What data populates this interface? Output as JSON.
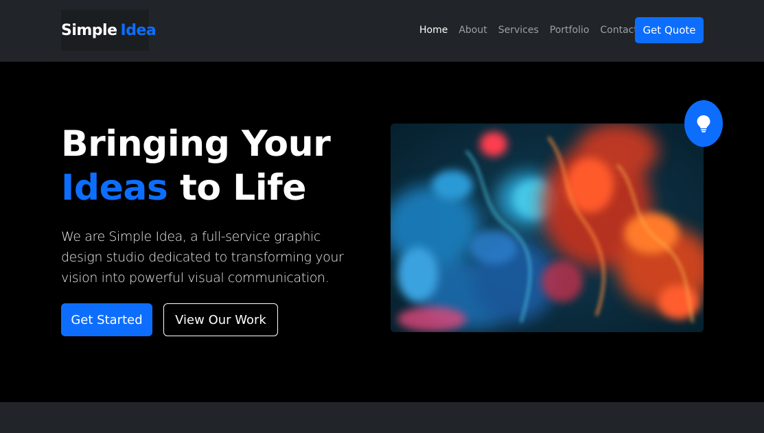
{
  "brand": {
    "name": "Simple",
    "accent": "Idea"
  },
  "nav": {
    "links": [
      {
        "label": "Home",
        "active": true
      },
      {
        "label": "About",
        "active": false
      },
      {
        "label": "Services",
        "active": false
      },
      {
        "label": "Portfolio",
        "active": false
      },
      {
        "label": "Contact",
        "active": false
      }
    ],
    "cta_label": "Get Quote"
  },
  "hero": {
    "title_line1": "Bringing Your",
    "title_accent": "Ideas",
    "title_rest": "to Life",
    "description": "We are Simple Idea, a full-service graphic design studio dedicated to transforming your vision into powerful visual communication.",
    "primary_button": "Get Started",
    "secondary_button": "View Our Work",
    "image_icon": "abstract-ink-image",
    "badge_icon": "lightbulb-icon"
  },
  "colors": {
    "accent": "#0d6efd",
    "navbar_bg": "#212529",
    "page_bg": "#000000"
  }
}
